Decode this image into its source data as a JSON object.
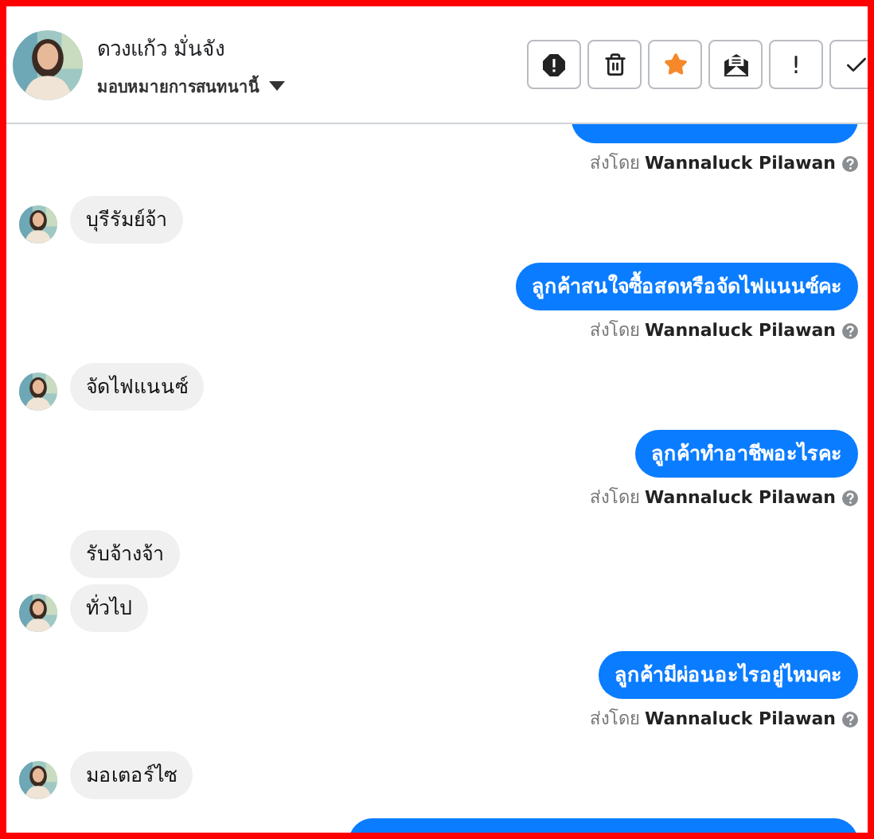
{
  "contact": {
    "name": "ดวงแก้ว มั่นจัง",
    "assign_label": "มอบหมายการสนทนานี้"
  },
  "toolbar": [
    {
      "kind": "alert"
    },
    {
      "kind": "trash"
    },
    {
      "kind": "star"
    },
    {
      "kind": "mail"
    },
    {
      "kind": "text",
      "label": "!"
    },
    {
      "kind": "check"
    }
  ],
  "messages": [
    {
      "kind": "outgoing",
      "sender_prefix": "ส่งโดย",
      "sender": "Wannaluck Pilawan"
    },
    {
      "kind": "incoming",
      "avatar": true,
      "text": "บุรีรัมย์จ้า"
    },
    {
      "kind": "outgoing",
      "text": "ลูกค้าสนใจซื้อสดหรือจัดไฟแนนซ์คะ",
      "sender_prefix": "ส่งโดย",
      "sender": "Wannaluck Pilawan"
    },
    {
      "kind": "incoming",
      "avatar": true,
      "text": "จัดไฟแนนซ์"
    },
    {
      "kind": "outgoing",
      "text": "ลูกค้าทำอาชีพอะไรคะ",
      "sender_prefix": "ส่งโดย",
      "sender": "Wannaluck Pilawan"
    },
    {
      "kind": "incoming",
      "avatar": false,
      "text": "รับจ้างจ้า"
    },
    {
      "kind": "incoming",
      "avatar": true,
      "text": "ทั่วไป"
    },
    {
      "kind": "outgoing",
      "text": "ลูกค้ามีผ่อนอะไรอยู่ไหมคะ",
      "sender_prefix": "ส่งโดย",
      "sender": "Wannaluck Pilawan"
    },
    {
      "kind": "incoming",
      "avatar": true,
      "text": "มอเตอร์ไซ"
    },
    {
      "kind": "outgoing"
    }
  ]
}
